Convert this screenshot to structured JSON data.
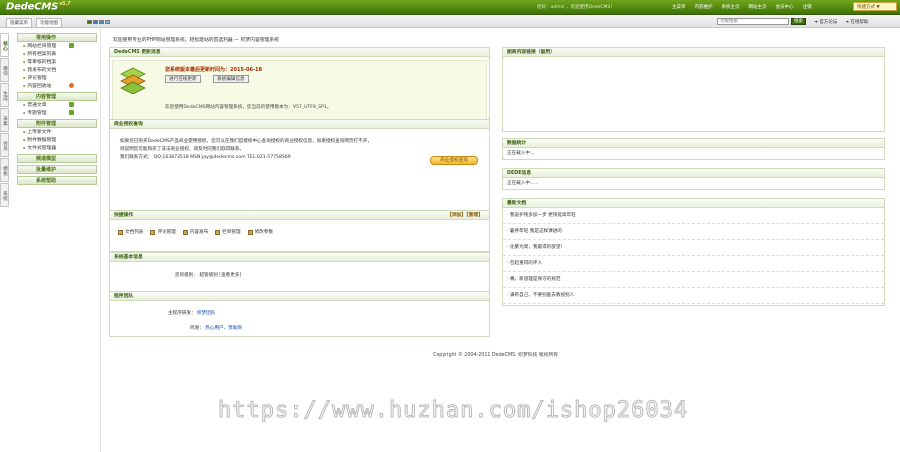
{
  "header": {
    "logo": "DedeCMS",
    "version": "v5.7",
    "welcome": "您好：admin ，欢迎使用DedeCMS！",
    "nav": [
      "主菜单",
      "内容维护",
      "系统主页",
      "网站主页",
      "会员中心",
      "注销"
    ],
    "quick_button": "快捷方式 ▼"
  },
  "subbar": {
    "hide_menu": "隐藏菜单",
    "function_map": "功能地图",
    "search_placeholder": "功能搜索",
    "search_button": "搜索",
    "links": [
      "官方论坛",
      "在线帮助"
    ],
    "swatch_colors": [
      "#3b6d05",
      "#2e7fd0",
      "#4a94d5",
      "#8bb0d1"
    ]
  },
  "tabs": [
    "核心",
    "模块",
    "生成",
    "采集",
    "会员",
    "模板",
    "系统"
  ],
  "sidebar": [
    {
      "title": "常用操作",
      "items": [
        "网站栏目管理",
        "所有档案列表",
        "等审核的档案",
        "我发布的文档",
        "评论管理",
        "内容回收站"
      ]
    },
    {
      "title": "内容管理",
      "items": [
        "普通文章",
        "专题管理"
      ]
    },
    {
      "title": "附件管理",
      "items": [
        "上传新文件",
        "附件数据管理",
        "文件式管理器"
      ]
    },
    {
      "title": "频道模型",
      "items": []
    },
    {
      "title": "批量维护",
      "items": []
    },
    {
      "title": "系统帮助",
      "items": []
    }
  ],
  "breadcrumb": "欢迎使用专业的PHP网站管理系统，轻松建站的首选利器 — 织梦内容管理系统",
  "update": {
    "title": "DedeCMS 更新消息",
    "latest": "您系统版本最后更新时间为：2015-06-18",
    "btn_check": "进行在线更新",
    "btn_archive": "系统编辑信息",
    "desc": "欢迎使用DedeCMS网站内容管理系统，您当前的使用版本为：V57_UTF8_SP1。"
  },
  "business": {
    "title": "商业授权查询",
    "lines": [
      "如果您已购买DedeCMS产品商业使用授权，您可以在我们官授权中心查询授权的商业授权信息，如果授权查询网页打不开，",
      "则说明您可能购买了非法商业授权，请及时同我们取得联系。",
      "我们联系方式：  QQ:163873518 MSN:jay@dedecms.com TEL:021-57758569"
    ],
    "button": "商业授权查询"
  },
  "quick_ops": {
    "title": "快捷操作",
    "right": "【添加】【管理】",
    "items": [
      "文档列表",
      "评论管理",
      "内容发布",
      "栏目管理",
      "修改参数"
    ]
  },
  "sysinfo": {
    "title": "系统基本信息",
    "label": "您的级别：",
    "value": "超管级别 [查看更多]"
  },
  "team": {
    "title": "程序团队",
    "rows": [
      {
        "k": "主程序研发：",
        "v": "织梦团队"
      },
      {
        "k": "鸣谢：",
        "v": "热心用户、赞助商"
      }
    ]
  },
  "news_right": {
    "title": "图商内容链接（副用）"
  },
  "data_stats": {
    "title": "数据统计",
    "text": "正在载入中..."
  },
  "dede_info": {
    "title": "DEDE信息",
    "text": "正在载入中......"
  },
  "latest_docs": {
    "title": "最新文档",
    "items": [
      "我奋护钱多加一步 更快提高年轻",
      "暑养年轻 我是这样课进的",
      "化繁为简，我最得的欲望！",
      "包起重得的评入",
      "嘴，新道理是保守的规范",
      "满有自己，不要别差去教视别人"
    ]
  },
  "footer": "Copyright © 2004-2011 DedeCMS. 织梦科技 版权所有",
  "watermark": "https://www.huzhan.com/ishop26034"
}
